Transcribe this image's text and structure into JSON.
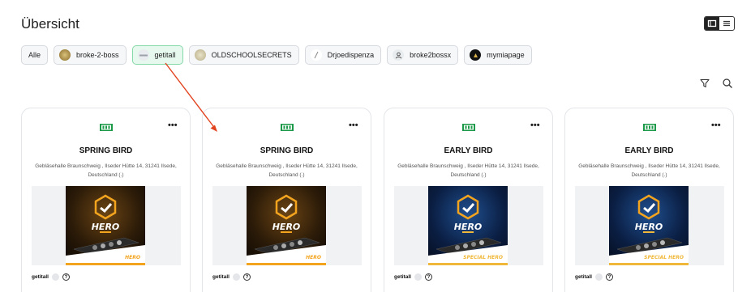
{
  "page": {
    "title": "Übersicht"
  },
  "view_toggle": {
    "active": "grid",
    "grid_icon": "grid-view-icon",
    "list_icon": "list-view-icon"
  },
  "filters": [
    {
      "label": "Alle",
      "selected": false,
      "avatar": ""
    },
    {
      "label": "broke-2-boss",
      "selected": false,
      "avatar": "broke-2-boss-avatar"
    },
    {
      "label": "getitall",
      "selected": true,
      "avatar": "getitall-avatar"
    },
    {
      "label": "OLDSCHOOLSECRETS",
      "selected": false,
      "avatar": "oldschoolsecrets-avatar"
    },
    {
      "label": "Drjoedispenza",
      "selected": false,
      "avatar": "drjoedispenza-avatar"
    },
    {
      "label": "broke2bossx",
      "selected": false,
      "avatar": "user-icon"
    },
    {
      "label": "mymiapage",
      "selected": false,
      "avatar": "mymiapage-avatar"
    }
  ],
  "toolbar": {
    "filter_icon": "filter-icon",
    "search_icon": "search-icon"
  },
  "cards": [
    {
      "title": "SPRING BIRD",
      "address": "Gebläsehalle Braunschweig , Ilseder Hütte 14, 31241 Ilsede, Deutschland (.)",
      "poster_label": "HERO",
      "footer_name": "getitall",
      "help": "?",
      "variant": "gold"
    },
    {
      "title": "SPRING BIRD",
      "address": "Gebläsehalle Braunschweig , Ilseder Hütte 14, 31241 Ilsede, Deutschland (.)",
      "poster_label": "HERO",
      "footer_name": "getitall",
      "help": "?",
      "variant": "gold"
    },
    {
      "title": "EARLY BIRD",
      "address": "Gebläsehalle Braunschweig , Ilseder Hütte 14, 31241 Ilsede, Deutschland (.)",
      "poster_label": "SPECIAL HERO",
      "footer_name": "getitall",
      "help": "?",
      "variant": "blue"
    },
    {
      "title": "EARLY BIRD",
      "address": "Gebläsehalle Braunschweig , Ilseder Hütte 14, 31241 Ilsede, Deutschland (.)",
      "poster_label": "SPECIAL HERO",
      "footer_name": "getitall",
      "help": "?",
      "variant": "blue"
    }
  ],
  "more_label": "•••",
  "colors": {
    "accent_green": "#86d9a8",
    "annotation_arrow": "#e2431f"
  }
}
